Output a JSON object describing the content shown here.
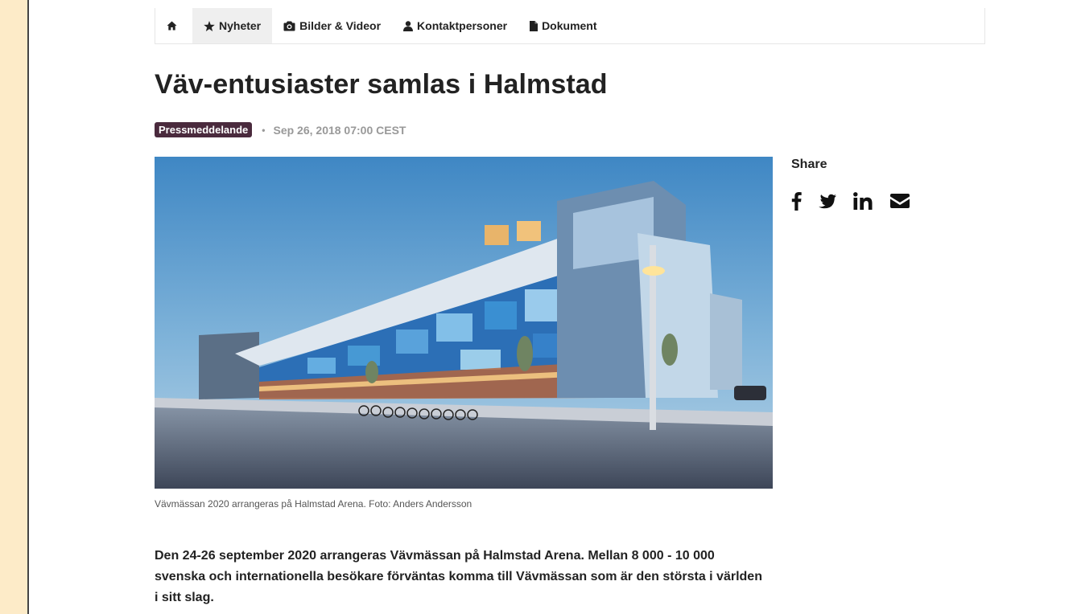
{
  "nav": {
    "home_icon": "home-icon",
    "items": [
      {
        "label": "Nyheter",
        "icon": "star-icon",
        "active": true
      },
      {
        "label": "Bilder & Videor",
        "icon": "camera-icon"
      },
      {
        "label": "Kontaktpersoner",
        "icon": "user-icon"
      },
      {
        "label": "Dokument",
        "icon": "file-icon"
      }
    ]
  },
  "article": {
    "title": "Väv-entusiaster samlas i Halmstad",
    "badge": "Pressmeddelande",
    "date": "Sep 26, 2018 07:00 CEST",
    "image_caption": "Vävmässan 2020 arrangeras på Halmstad Arena. Foto: Anders Andersson",
    "lead": "Den 24-26 september 2020 arrangeras Vävmässan på Halmstad Arena. Mellan 8 000 - 10 000 svenska och internationella besökare förväntas komma till Vävmässan som är den största i världen i sitt slag."
  },
  "share": {
    "label": "Share",
    "icons": [
      "facebook-icon",
      "twitter-icon",
      "linkedin-icon",
      "email-icon"
    ]
  },
  "colors": {
    "badge_bg": "#4a2a3d",
    "page_bg": "#fdebc8"
  }
}
